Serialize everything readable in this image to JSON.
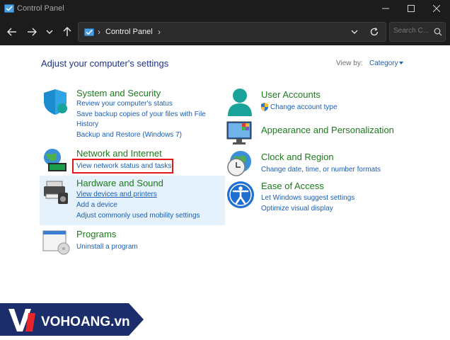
{
  "window": {
    "title": "Control Panel"
  },
  "navbar": {
    "breadcrumb": "Control Panel",
    "search_placeholder": "Search C..."
  },
  "content": {
    "heading": "Adjust your computer's settings",
    "view_by_label": "View by:",
    "view_by_value": "Category"
  },
  "categories": {
    "system_security": {
      "title": "System and Security",
      "links": [
        "Review your computer's status",
        "Save backup copies of your files with File",
        "History",
        "Backup and Restore (Windows 7)"
      ]
    },
    "network": {
      "title": "Network and Internet",
      "links": [
        "View network status and tasks"
      ]
    },
    "hardware": {
      "title": "Hardware and Sound",
      "links": [
        "View devices and printers",
        "Add a device",
        "Adjust commonly used mobility settings"
      ]
    },
    "programs": {
      "title": "Programs",
      "links": [
        "Uninstall a program"
      ]
    },
    "user_accounts": {
      "title": "User Accounts",
      "links": [
        "Change account type"
      ]
    },
    "appearance": {
      "title": "Appearance and Personalization"
    },
    "clock": {
      "title": "Clock and Region",
      "links": [
        "Change date, time, or number formats"
      ]
    },
    "ease": {
      "title": "Ease of Access",
      "links": [
        "Let Windows suggest settings",
        "Optimize visual display"
      ]
    }
  },
  "watermark": {
    "brand": "VOHOANG.vn"
  },
  "colors": {
    "titlebar_bg": "#1c1c1c",
    "category_title": "#1e7a1e",
    "link": "#1a5fb4",
    "heading": "#1e3287",
    "highlight_bg": "#e5f1fb",
    "red_box": "#e01818",
    "watermark_bg": "#1b2d6b"
  },
  "icons": [
    "control-panel-icon",
    "minimize-icon",
    "maximize-icon",
    "close-icon",
    "back-arrow-icon",
    "forward-arrow-icon",
    "chevron-down-icon",
    "up-arrow-icon",
    "refresh-icon",
    "search-icon",
    "shield-icon",
    "network-icon",
    "printer-icon",
    "programs-icon",
    "user-icon",
    "uac-shield-icon",
    "appearance-icon",
    "clock-icon",
    "accessibility-icon"
  ]
}
